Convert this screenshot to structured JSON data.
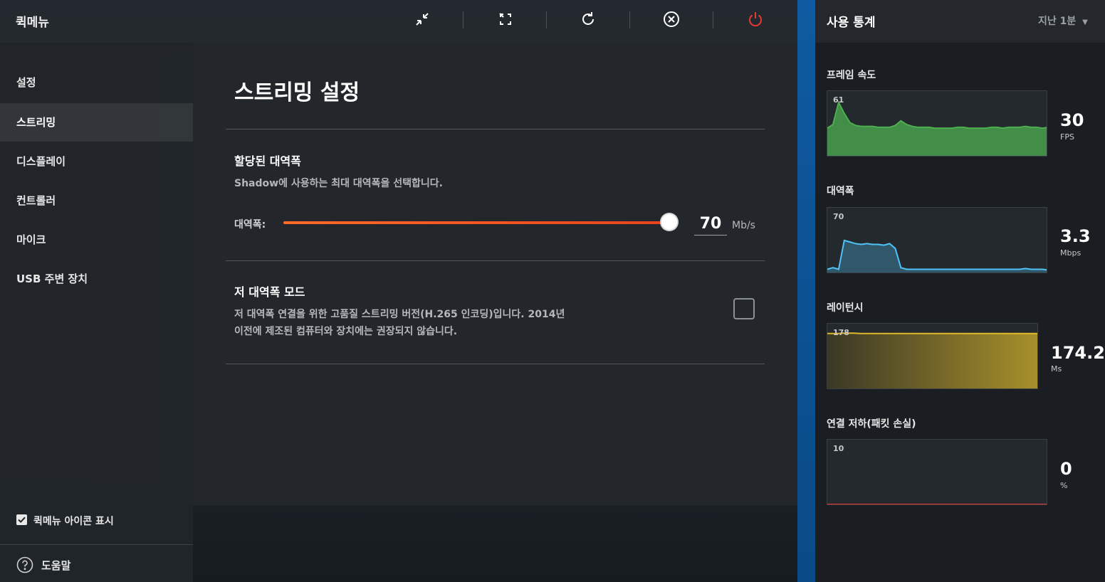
{
  "app": {
    "title": "퀵메뉴"
  },
  "toolbar": {
    "icons": [
      "collapse-icon",
      "fullscreen-icon",
      "refresh-icon",
      "close-circle-icon",
      "power-icon"
    ],
    "power_color": "#e53935"
  },
  "sidebar": {
    "items": [
      {
        "label": "설정"
      },
      {
        "label": "스트리밍"
      },
      {
        "label": "디스플레이"
      },
      {
        "label": "컨트롤러"
      },
      {
        "label": "마이크"
      },
      {
        "label": "USB 주변 장치"
      }
    ],
    "active_index": 1,
    "quickmenu_icon_label": "퀵메뉴 아이콘 표시",
    "quickmenu_icon_checked": true,
    "help_label": "도움말"
  },
  "streaming": {
    "title": "스트리밍 설정",
    "bandwidth": {
      "heading": "할당된 대역폭",
      "description": "Shadow에 사용하는 최대 대역폭을 선택합니다.",
      "label": "대역폭:",
      "value": "70",
      "unit": "Mb/s",
      "slider_fraction": 1.0,
      "accent": "#f05a28"
    },
    "low_bandwidth": {
      "heading": "저 대역폭 모드",
      "description_line1": "저 대역폭 연결을 위한 고품질 스트리밍 버전(H.265 인코딩)입니다. 2014년",
      "description_line2": "이전에 제조된 컴퓨터와 장치에는 권장되지 않습니다.",
      "checked": false
    }
  },
  "stats": {
    "title": "사용 통계",
    "period": "지난 1분",
    "framerate": {
      "label": "프레임 속도",
      "max": "61",
      "value": "30",
      "unit": "FPS",
      "color": "#4caf50",
      "series": [
        30,
        34,
        58,
        46,
        36,
        33,
        32,
        32,
        32,
        31,
        31,
        31,
        33,
        38,
        34,
        32,
        31,
        31,
        31,
        30,
        30,
        30,
        30,
        31,
        31,
        30,
        30,
        30,
        30,
        31,
        31,
        30,
        31,
        31,
        31,
        32,
        31,
        31,
        30,
        31
      ]
    },
    "bandwidth": {
      "label": "대역폭",
      "max": "70",
      "value": "3.3",
      "unit": "Mbps",
      "color": "#4fc3f7",
      "series": [
        4,
        6,
        4,
        40,
        38,
        36,
        35,
        36,
        35,
        35,
        34,
        36,
        30,
        6,
        4,
        4,
        4,
        4,
        4,
        4,
        4,
        4,
        4,
        4,
        4,
        4,
        4,
        4,
        4,
        4,
        4,
        4,
        4,
        4,
        4,
        5,
        4,
        4,
        4,
        3
      ]
    },
    "latency": {
      "label": "레이턴시",
      "max": "178",
      "value": "174.2",
      "unit": "Ms",
      "color": "#e0b82a",
      "series": [
        174,
        174,
        174,
        175,
        175,
        175,
        174,
        174,
        174,
        174,
        174,
        174,
        174,
        174,
        174,
        174,
        174,
        174,
        174,
        174,
        174,
        174,
        174,
        174,
        174,
        174,
        174,
        174,
        174,
        174,
        174,
        174,
        174,
        174,
        174,
        174,
        174,
        174,
        174,
        174
      ]
    },
    "packet_loss": {
      "label": "연결 저하(패킷 손실)",
      "max": "10",
      "value": "0",
      "unit": "%",
      "color": "#e53935",
      "series": [
        0,
        0,
        0,
        0,
        0,
        0,
        0,
        0,
        0,
        0
      ]
    }
  }
}
